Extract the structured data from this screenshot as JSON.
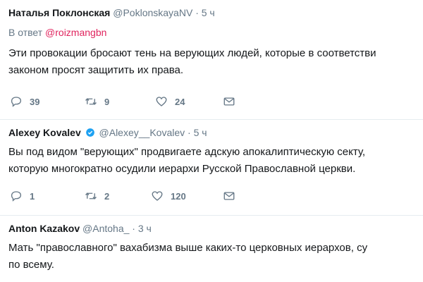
{
  "tweets": [
    {
      "name": "Наталья Поклонская",
      "handle": "@PoklonskayaNV",
      "sep": "·",
      "time": "5 ч",
      "reply_prefix": "В ответ",
      "reply_to": "@roizmangbn",
      "text_lines": [
        "Эти провокации бросают тень на верующих людей, которые в соответстви",
        "законом просят защитить их права."
      ],
      "replies": "39",
      "retweets": "9",
      "likes": "24"
    },
    {
      "name": "Alexey Kovalev",
      "handle": "@Alexey__Kovalev",
      "sep": "·",
      "time": "5 ч",
      "verified": true,
      "text_lines": [
        "Вы под видом \"верующих\" продвигаете адскую апокалиптическую секту,",
        "которую многократно осудили иерархи Русской Православной церкви."
      ],
      "replies": "1",
      "retweets": "2",
      "likes": "120"
    },
    {
      "name": "Anton Kazakov",
      "handle": "@Antoha_",
      "sep": "·",
      "time": "3 ч",
      "text_lines": [
        "Мать \"православного\" вахабизма выше каких-то церковных иерархов, су",
        "по всему."
      ]
    }
  ],
  "colors": {
    "accent_mention": "#e0245e",
    "muted": "#657786",
    "verified_blue": "#1da1f2",
    "divider": "#e6ecf0"
  },
  "icons": [
    "reply-icon",
    "retweet-icon",
    "like-icon",
    "direct-message-icon",
    "verified-badge-icon"
  ]
}
